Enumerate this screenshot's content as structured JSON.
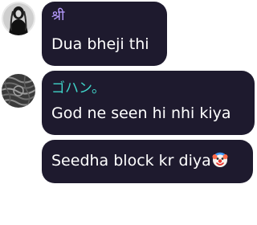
{
  "colors": {
    "bubble_bg": "#1e1a2e",
    "sender1_name": "#b79cff",
    "sender2_name": "#3fd3c8",
    "text": "#ffffff"
  },
  "messages": [
    {
      "sender": "श्री",
      "sender_color": "#b79cff",
      "lines": [
        "Dua bheji thi"
      ]
    },
    {
      "sender": "ゴハン。",
      "sender_color": "#3fd3c8",
      "lines": [
        "God ne seen hi nhi kiya",
        "Seedha block kr diya"
      ],
      "trailing_icon": "clown-face-icon"
    }
  ]
}
